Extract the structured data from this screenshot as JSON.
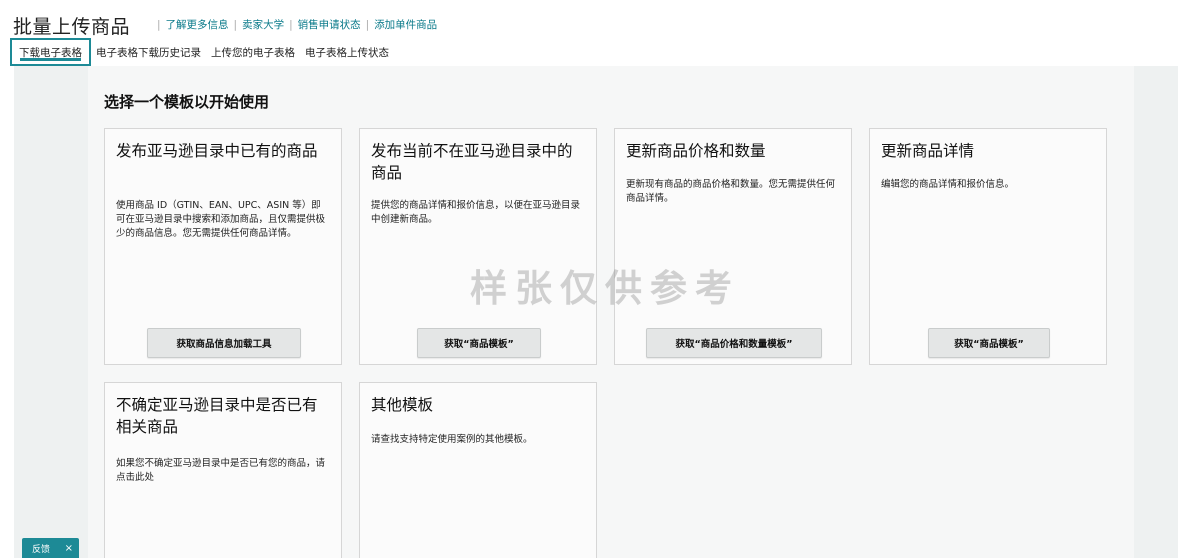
{
  "header": {
    "title": "批量上传商品",
    "links": [
      "了解更多信息",
      "卖家大学",
      "销售申请状态",
      "添加单件商品"
    ]
  },
  "tabs": [
    "下载电子表格",
    "电子表格下载历史记录",
    "上传您的电子表格",
    "电子表格上传状态"
  ],
  "section_title": "选择一个模板以开始使用",
  "cards": [
    {
      "title": "发布亚马逊目录中已有的商品",
      "description": "使用商品 ID（GTIN、EAN、UPC、ASIN 等）即可在亚马逊目录中搜索和添加商品，且仅需提供极少的商品信息。您无需提供任何商品详情。",
      "button": "获取商品信息加载工具"
    },
    {
      "title": "发布当前不在亚马逊目录中的商品",
      "description": "提供您的商品详情和报价信息，以便在亚马逊目录中创建新商品。",
      "button": "获取“商品模板”"
    },
    {
      "title": "更新商品价格和数量",
      "description": "更新现有商品的商品价格和数量。您无需提供任何商品详情。",
      "button": "获取“商品价格和数量模板”"
    },
    {
      "title": "更新商品详情",
      "description": "编辑您的商品详情和报价信息。",
      "button": "获取“商品模板”"
    },
    {
      "title": "不确定亚马逊目录中是否已有相关商品",
      "description": "如果您不确定亚马逊目录中是否已有您的商品，请点击此处"
    },
    {
      "title": "其他模板",
      "description": "请查找支持特定使用案例的其他模板。"
    }
  ],
  "watermark": "样张仅供参考",
  "feedback": {
    "label": "反馈",
    "close": "×"
  },
  "colors": {
    "accent": "#1d8a96",
    "link": "#0a7a8a"
  }
}
